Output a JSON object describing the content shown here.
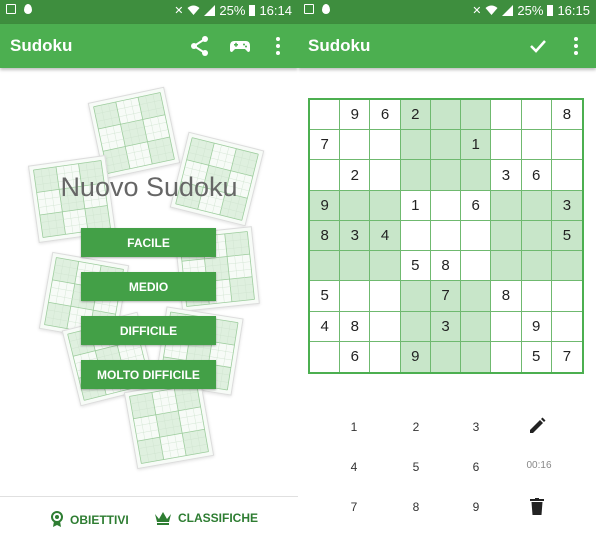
{
  "status_left": {
    "battery": "25%",
    "time": "16:14"
  },
  "status_right": {
    "battery": "25%",
    "time": "16:15"
  },
  "left_app": {
    "title": "Sudoku",
    "headline": "Nuovo Sudoku",
    "buttons": [
      "FACILE",
      "MEDIO",
      "DIFFICILE",
      "MOLTO DIFFICILE"
    ],
    "bottom": {
      "achievements": "OBIETTIVI",
      "leaderboards": "CLASSIFICHE"
    },
    "icons": [
      "share-icon",
      "gamepad-icon",
      "more-vert-icon"
    ]
  },
  "right_app": {
    "title": "Sudoku",
    "icons": [
      "check-icon",
      "more-vert-icon"
    ],
    "board": [
      [
        "",
        "9",
        "6",
        "2",
        "",
        "",
        "",
        "",
        "8"
      ],
      [
        "7",
        "",
        "",
        "",
        "",
        "1",
        "",
        "",
        ""
      ],
      [
        "",
        "2",
        "",
        "",
        "",
        "",
        "3",
        "6",
        ""
      ],
      [
        "9",
        "",
        "",
        "1",
        "",
        "6",
        "",
        "",
        "3"
      ],
      [
        "8",
        "3",
        "4",
        "",
        "",
        "",
        "",
        "",
        "5"
      ],
      [
        "",
        "",
        "",
        "5",
        "8",
        "",
        "",
        "",
        ""
      ],
      [
        "5",
        "",
        "",
        "",
        "7",
        "",
        "8",
        "",
        ""
      ],
      [
        "4",
        "8",
        "",
        "",
        "3",
        "",
        "",
        "9",
        ""
      ],
      [
        "",
        "6",
        "",
        "9",
        "",
        "",
        "",
        "5",
        "7"
      ]
    ],
    "keypad": [
      "1",
      "2",
      "3",
      "4",
      "5",
      "6",
      "7",
      "8",
      "9"
    ],
    "timer": "00:16",
    "tool_icons": [
      "pencil-icon",
      "trash-icon"
    ]
  },
  "colors": {
    "status_bar": "#3e8e3e",
    "app_bar": "#4caf50",
    "button": "#43a047",
    "highlight": "#c8e6c9",
    "link": "#2e7d32"
  }
}
